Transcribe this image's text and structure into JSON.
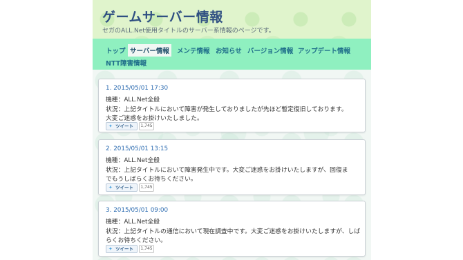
{
  "site": {
    "title": "ゲームサーバー情報",
    "subtitle": "セガのALL.Net使用タイトルのサーバー系情報のページです。"
  },
  "nav": {
    "items": [
      {
        "label": "トップ",
        "active": false
      },
      {
        "label": "サーバー情報",
        "active": true
      },
      {
        "label": "メンテ情報",
        "active": false
      },
      {
        "label": "お知らせ",
        "active": false
      },
      {
        "label": "バージョン情報",
        "active": false
      },
      {
        "label": "アップデート情報",
        "active": false
      },
      {
        "label": "NTT障害情報",
        "active": false
      }
    ]
  },
  "entries": [
    {
      "date": "1. 2015/05/01 17:30",
      "model": "機種：ALL.Net全般",
      "status_lines": [
        "状況：上記タイトルにおいて障害が発生しておりましたが先ほど暫定復旧しております。",
        "大変ご迷惑をお掛けいたしました。"
      ],
      "tweet_label": "ツイート",
      "tweet_count": "1,745"
    },
    {
      "date": "2. 2015/05/01 13:15",
      "model": "機種：ALL.Net全般",
      "status_lines": [
        "状況：上記タイトルにおいて障害発生中です。大変ご迷惑をお掛けいたしますが、回復ま",
        "でもうしばらくお待ちください。"
      ],
      "tweet_label": "ツイート",
      "tweet_count": "1,745"
    },
    {
      "date": "3. 2015/05/01 09:00",
      "model": "機種：ALL.Net全般",
      "status_lines": [
        "状況：上記タイトルの通信において現在調査中です。大変ご迷惑をお掛けいたしますが、しば",
        "らくお待ちください。"
      ],
      "tweet_label": "ツイート",
      "tweet_count": "1,745"
    }
  ]
}
